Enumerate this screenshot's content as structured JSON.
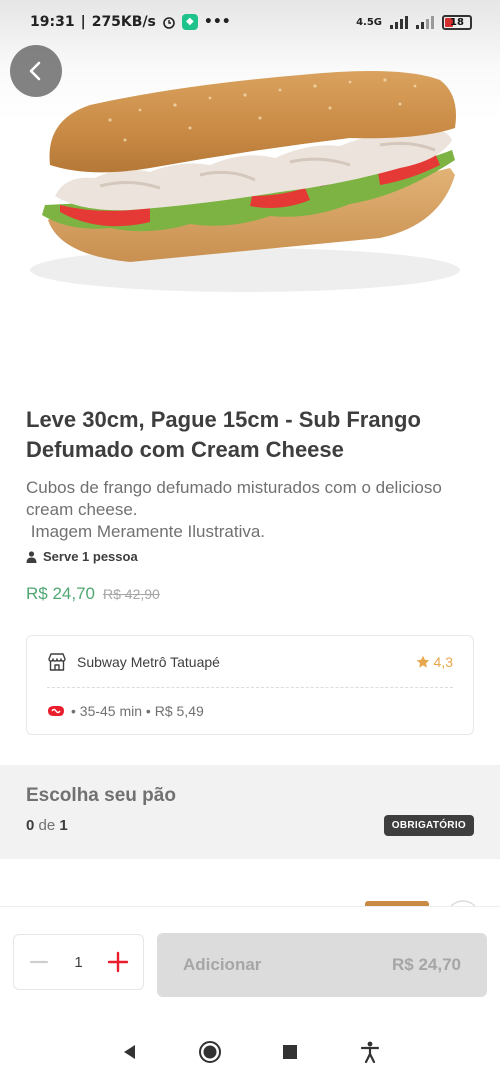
{
  "status_bar": {
    "time": "19:31",
    "speed": "275KB/s",
    "network": "4.5G",
    "battery": "18"
  },
  "header": {
    "back_icon": "chevron-left-icon"
  },
  "product": {
    "title": "Leve 30cm, Pague 15cm - Sub Frango Defumado com Cream Cheese",
    "description_line1": "Cubos de frango defumado misturados com o delicioso cream cheese.",
    "description_line2": " Imagem Meramente Ilustrativa.",
    "serves": "Serve 1 pessoa",
    "price": "R$ 24,70",
    "old_price": "R$ 42,90"
  },
  "store": {
    "name": "Subway Metrô Tatuapé",
    "rating": "4,3",
    "delivery_info": "• 35-45 min • R$ 5,49",
    "icons": {
      "store": "storefront-icon",
      "rating": "star-icon",
      "delivery": "delivery-badge-icon"
    }
  },
  "options_section": {
    "title": "Escolha seu pão",
    "count_selected": "0",
    "count_of": "de",
    "count_total": "1",
    "badge": "OBRIGATÓRIO"
  },
  "cart": {
    "quantity": "1",
    "add_label": "Adicionar",
    "add_price": "R$ 24,70"
  },
  "colors": {
    "price_green": "#50a773",
    "accent_red": "#ea1d2c",
    "star": "#e7a74e",
    "disabled_button": "#dcdcdc"
  }
}
